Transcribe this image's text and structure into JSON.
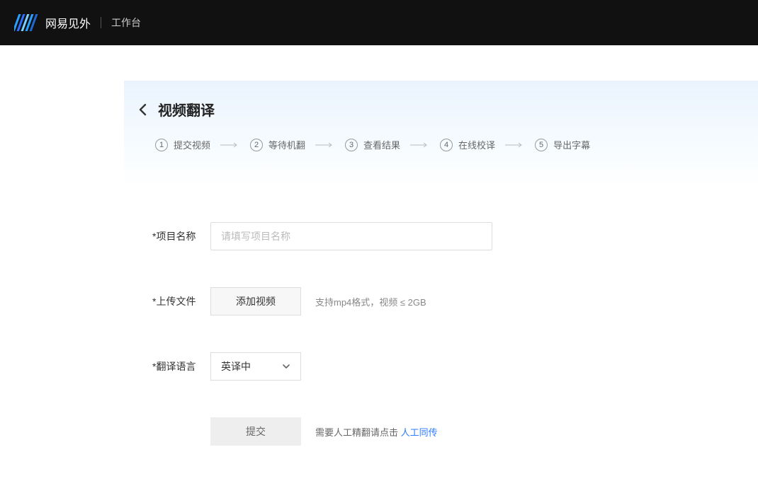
{
  "header": {
    "brand": "网易见外",
    "workspace": "工作台"
  },
  "page": {
    "title": "视频翻译",
    "steps": [
      "提交视频",
      "等待机翻",
      "查看结果",
      "在线校译",
      "导出字幕"
    ]
  },
  "form": {
    "projectName": {
      "label": "*项目名称",
      "placeholder": "请填写项目名称",
      "value": ""
    },
    "upload": {
      "label": "*上传文件",
      "button": "添加视频",
      "hint": "支持mp4格式，视频 ≤ 2GB"
    },
    "language": {
      "label": "*翻译语言",
      "selected": "英译中"
    },
    "submit": {
      "label": "提交",
      "hint": "需要人工精翻请点击 ",
      "link": "人工同传"
    }
  }
}
